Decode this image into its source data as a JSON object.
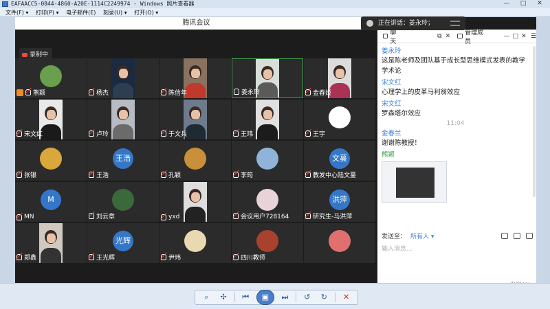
{
  "window": {
    "title": "EAFAACC5-0844-4860-A20E-1114C2249974 - Windows 照片查看器",
    "minimize": "—",
    "maximize": "□",
    "close": "✕"
  },
  "menu": [
    "文件(F) ▾",
    "打印(P) ▾",
    "电子邮件(E)",
    "刻录(U) ▾",
    "打开(O) ▾"
  ],
  "meeting": {
    "title": "腾讯会议",
    "recording": "录制中",
    "speaking": "正在讲话：姜永玲；"
  },
  "participants": [
    {
      "name": "熊颖",
      "type": "pic",
      "color": "#6a9f4d",
      "host": true
    },
    {
      "name": "杨杰",
      "type": "photo",
      "bg": "#1b2a40",
      "body": "#2c3e50"
    },
    {
      "name": "陈信年",
      "type": "photo",
      "bg": "#8a7260",
      "body": "#c0392b"
    },
    {
      "name": "姜永玲",
      "type": "photo",
      "bg": "#d8ded8",
      "body": "#5a5a5a",
      "speaking": true
    },
    {
      "name": "金春姬",
      "type": "photo",
      "bg": "#dcdcdc",
      "body": "#aa3355"
    },
    {
      "name": "宋文红",
      "type": "photo",
      "bg": "#e9e9e9",
      "body": "#1a1a1a"
    },
    {
      "name": "卢玲",
      "type": "photo",
      "bg": "#b7bcc4",
      "body": "#6b6b6b"
    },
    {
      "name": "于文兵",
      "type": "photo",
      "bg": "#6e7b8c",
      "body": "#1f2a33"
    },
    {
      "name": "王玮",
      "type": "photo",
      "bg": "#e0e0e0",
      "body": "#1c1c1c"
    },
    {
      "name": "王宇",
      "type": "pic",
      "color": "#ffffff"
    },
    {
      "name": "张银",
      "type": "pic",
      "color": "#d9a73a"
    },
    {
      "name": "王浩",
      "type": "avatar",
      "avatar": "王浩"
    },
    {
      "name": "孔颖",
      "type": "pic",
      "color": "#c98f3a"
    },
    {
      "name": "李筠",
      "type": "pic",
      "color": "#8fb3d9"
    },
    {
      "name": "教发中心陆文蔓",
      "type": "avatar",
      "avatar": "文蔓"
    },
    {
      "name": "MN",
      "type": "avatar",
      "avatar": "M"
    },
    {
      "name": "刘云章",
      "type": "pic",
      "color": "#3a6a3a"
    },
    {
      "name": "yxd",
      "type": "photo",
      "bg": "#dedede",
      "body": "#222222"
    },
    {
      "name": "会议用户728164",
      "type": "pic",
      "color": "#e8d3d8"
    },
    {
      "name": "研究生-马洪萍",
      "type": "avatar",
      "avatar": "洪萍"
    },
    {
      "name": "郑鑫",
      "type": "photo",
      "bg": "#cfc9c1",
      "body": "#333333"
    },
    {
      "name": "王光辉",
      "type": "avatar",
      "avatar": "光辉"
    },
    {
      "name": "尹玮",
      "type": "pic",
      "color": "#e8d9b0"
    },
    {
      "name": "四川教师",
      "type": "pic",
      "color": "#a8412d"
    },
    {
      "name": "",
      "type": "pic",
      "color": "#e07070"
    }
  ],
  "panel": {
    "tab_chat": "聊天",
    "tab_members": "管理成员",
    "messages": [
      {
        "name": "姜永玲",
        "text": "这是陈老师及团队基于成长型思维模式发表的教学学术论",
        "time": ""
      },
      {
        "name": "宋文红",
        "text": "心理学上的皮革马利翁效应"
      },
      {
        "name": "宋文红",
        "text": "罗森塔尔效应"
      }
    ],
    "time_stamp": "11:04",
    "message_jin_name": "金春兰",
    "message_jin_text": "谢谢陈教授！",
    "message_xiong_name": "熊颖",
    "send_to_label": "发送至：",
    "send_to_value": "所有人 ▾",
    "input_placeholder": "输入消息...",
    "send_button": "发送(S)"
  }
}
